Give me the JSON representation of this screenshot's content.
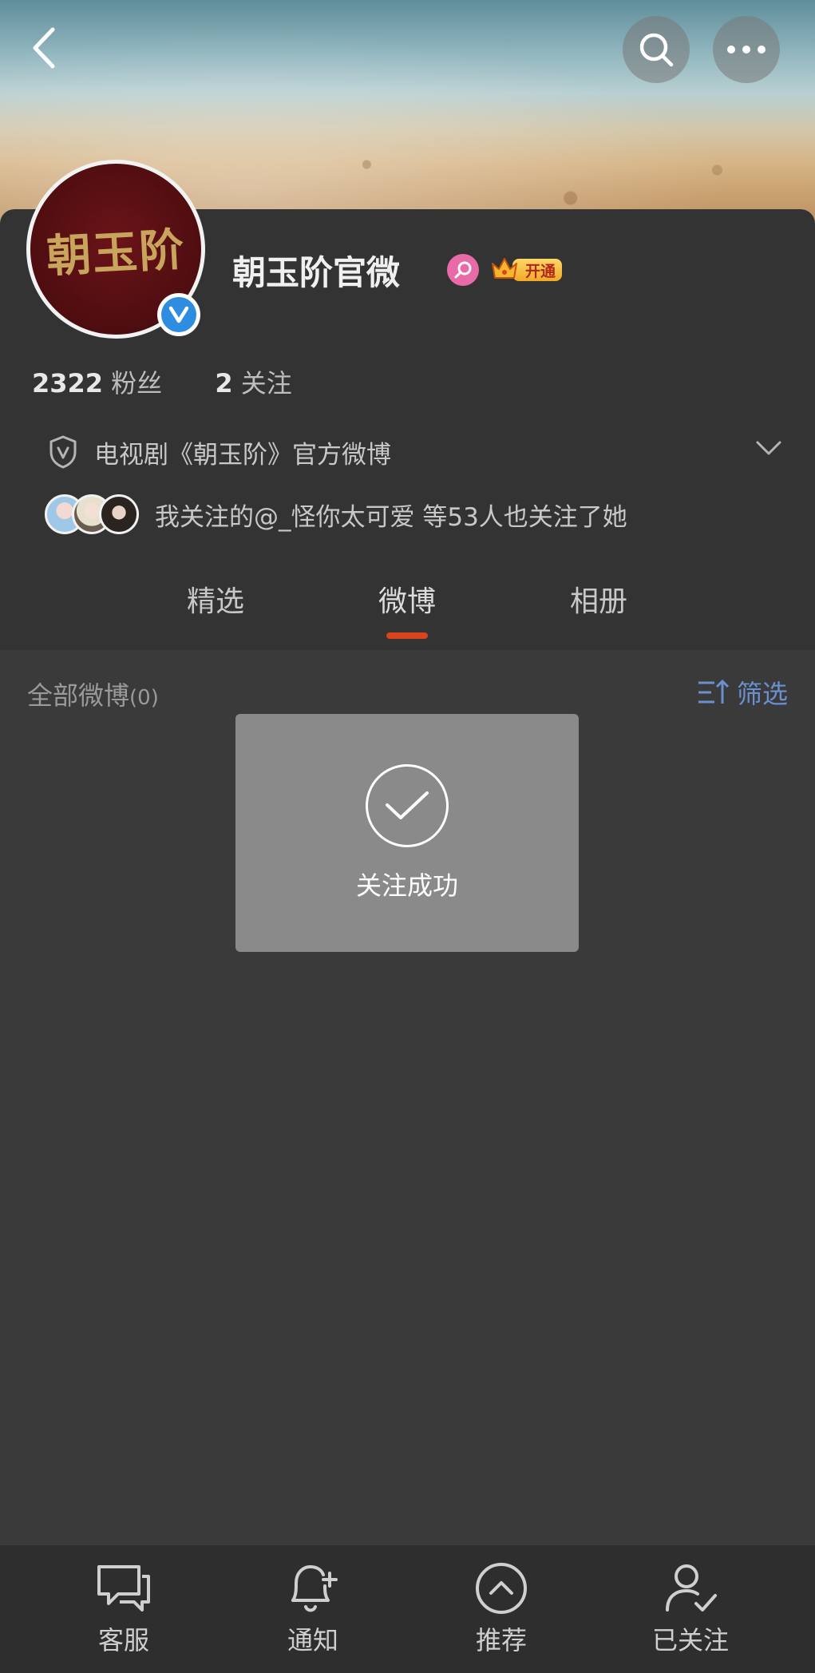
{
  "header": {
    "back_icon": "chevron-left-icon",
    "search_icon": "search-icon",
    "more_icon": "more-horizontal-icon"
  },
  "profile": {
    "avatar_text": "朝玉阶",
    "name": "朝玉阶官微",
    "verified_icon": "verified-v-icon",
    "gender_icon": "female-icon",
    "vip_label": "开通",
    "followers_count": "2322",
    "followers_label": "粉丝",
    "following_count": "2",
    "following_label": "关注",
    "description": "电视剧《朝玉阶》官方微博",
    "mutual_text": "我关注的@_怪你太可爱 等53人也关注了她"
  },
  "tabs": {
    "items": [
      {
        "label": "精选"
      },
      {
        "label": "微博"
      },
      {
        "label": "相册"
      }
    ],
    "active": "微博"
  },
  "posts": {
    "all_label": "全部微博",
    "count": "(0)",
    "filter_label": "筛选"
  },
  "toast": {
    "message": "关注成功"
  },
  "bottom_bar": {
    "items": [
      {
        "label": "客服",
        "icon": "chat-bubbles-icon"
      },
      {
        "label": "通知",
        "icon": "bell-plus-icon"
      },
      {
        "label": "推荐",
        "icon": "chevron-up-circle-icon"
      },
      {
        "label": "已关注",
        "icon": "user-check-icon"
      }
    ]
  },
  "colors": {
    "accent": "#d9441c",
    "verified": "#2e8de0",
    "link": "#6b8fcf",
    "background": "#353535"
  }
}
